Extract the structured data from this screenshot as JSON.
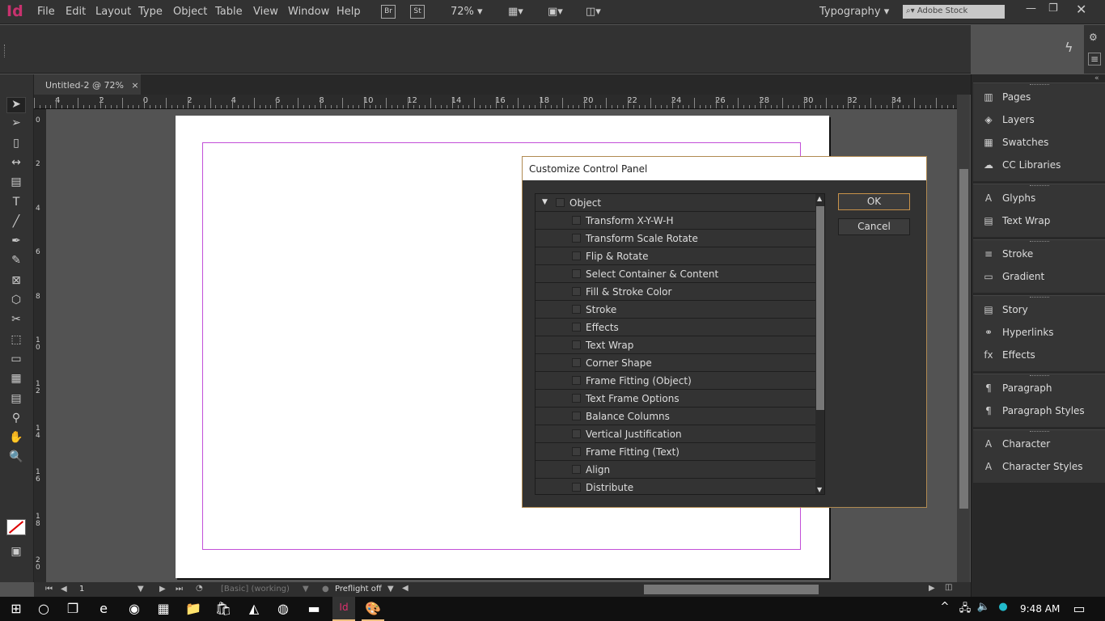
{
  "app": {
    "logo": "Id",
    "menu": [
      "File",
      "Edit",
      "Layout",
      "Type",
      "Object",
      "Table",
      "View",
      "Window",
      "Help"
    ],
    "bridge": "Br",
    "stock": "St",
    "zoom": "72%",
    "workspace": "Typography",
    "search_placeholder": "Adobe Stock"
  },
  "document": {
    "tab_title": "Untitled-2 @ 72%",
    "close": "×"
  },
  "rulers": {
    "horizontal": [
      "4",
      "2",
      "0",
      "2",
      "4",
      "6",
      "8",
      "10",
      "12",
      "14",
      "16",
      "18",
      "20",
      "22",
      "24",
      "26",
      "28",
      "30",
      "32",
      "34"
    ],
    "vertical": [
      "0",
      "2",
      "4",
      "6",
      "8",
      "10",
      "12",
      "14",
      "16",
      "18",
      "20"
    ]
  },
  "tools": [
    "selection",
    "direct-selection",
    "page",
    "gap",
    "content-collector",
    "type",
    "line",
    "pen",
    "pencil",
    "rectangle-frame",
    "polygon",
    "scissors",
    "free-transform",
    "gradient-swatch",
    "gradient-feather",
    "note",
    "eyedropper",
    "hand",
    "zoom"
  ],
  "status": {
    "page": "1",
    "style": "[Basic] (working)",
    "preflight": "Preflight off"
  },
  "panels": [
    [
      {
        "icon": "pages-icon",
        "glyph": "▥",
        "label": "Pages"
      },
      {
        "icon": "layers-icon",
        "glyph": "◈",
        "label": "Layers"
      },
      {
        "icon": "swatches-icon",
        "glyph": "▦",
        "label": "Swatches"
      },
      {
        "icon": "cc-libraries-icon",
        "glyph": "☁",
        "label": "CC Libraries"
      }
    ],
    [
      {
        "icon": "glyphs-icon",
        "glyph": "A",
        "label": "Glyphs"
      },
      {
        "icon": "text-wrap-icon",
        "glyph": "▤",
        "label": "Text Wrap"
      }
    ],
    [
      {
        "icon": "stroke-icon",
        "glyph": "≡",
        "label": "Stroke"
      },
      {
        "icon": "gradient-icon",
        "glyph": "▭",
        "label": "Gradient"
      }
    ],
    [
      {
        "icon": "story-icon",
        "glyph": "▤",
        "label": "Story"
      },
      {
        "icon": "hyperlinks-icon",
        "glyph": "⚭",
        "label": "Hyperlinks"
      },
      {
        "icon": "effects-icon",
        "glyph": "fx",
        "label": "Effects"
      }
    ],
    [
      {
        "icon": "paragraph-icon",
        "glyph": "¶",
        "label": "Paragraph"
      },
      {
        "icon": "paragraph-styles-icon",
        "glyph": "¶",
        "label": "Paragraph Styles"
      }
    ],
    [
      {
        "icon": "character-icon",
        "glyph": "A",
        "label": "Character"
      },
      {
        "icon": "character-styles-icon",
        "glyph": "A",
        "label": "Character Styles"
      }
    ]
  ],
  "dialog": {
    "title": "Customize Control Panel",
    "ok": "OK",
    "cancel": "Cancel",
    "group": "Object",
    "checked": false,
    "items": [
      "Transform X-Y-W-H",
      "Transform Scale Rotate",
      "Flip & Rotate",
      "Select Container & Content",
      "Fill & Stroke Color",
      "Stroke",
      "Effects",
      "Text Wrap",
      "Corner Shape",
      "Frame Fitting (Object)",
      "Text Frame Options",
      "Balance Columns",
      "Vertical Justification",
      "Frame Fitting (Text)",
      "Align",
      "Distribute"
    ]
  },
  "taskbar": {
    "time": "9:48 AM",
    "apps": [
      "start",
      "cortana",
      "task-view",
      "edge",
      "chrome",
      "calculator",
      "file-explorer",
      "store",
      "app-1",
      "app-2",
      "app-3",
      "indesign",
      "paint"
    ]
  },
  "colors": {
    "accent": "#c8326e",
    "guide": "#c24fd8",
    "dialog_border": "#b08a52"
  }
}
